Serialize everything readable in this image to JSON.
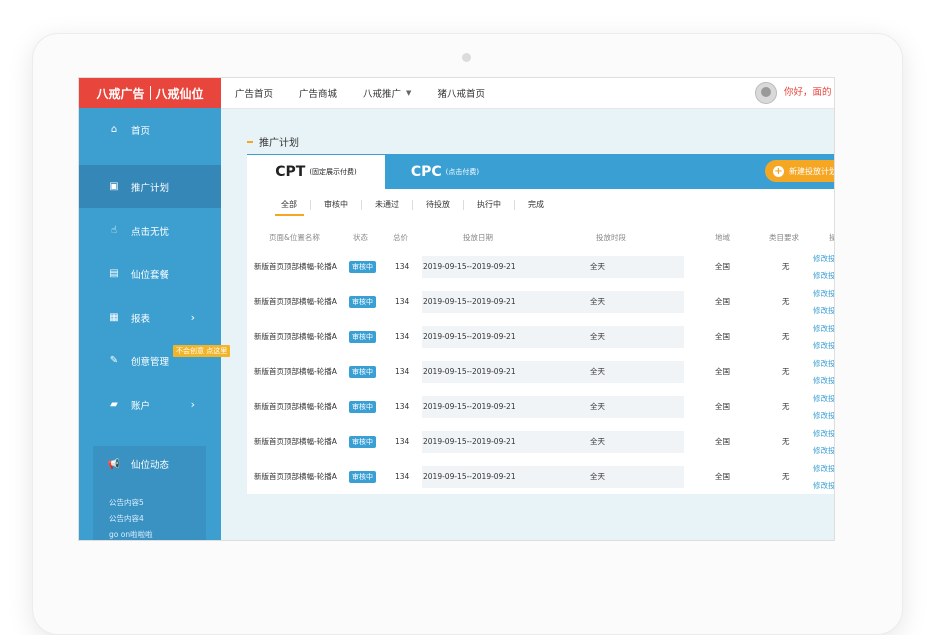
{
  "logo": {
    "left": "八戒广告",
    "right": "八戒仙位"
  },
  "topnav": [
    "广告首页",
    "广告商城",
    "八戒推广",
    "猪八戒首页"
  ],
  "user": {
    "greeting": "你好，面的"
  },
  "sidebar": {
    "items": [
      {
        "label": "首页",
        "icon": "home-icon"
      },
      {
        "label": "推广计划",
        "icon": "promotion-plan-icon"
      },
      {
        "label": "点击无忧",
        "icon": "click-icon"
      },
      {
        "label": "仙位套餐",
        "icon": "package-icon"
      },
      {
        "label": "报表",
        "icon": "report-icon"
      },
      {
        "label": "创意管理",
        "icon": "brush-icon"
      },
      {
        "label": "账户",
        "icon": "account-icon"
      }
    ],
    "hint": "不会创意 点这里",
    "dynamic": {
      "title": "仙位动态",
      "items": [
        "公告内容5",
        "公告内容4",
        "go on啦啦啦"
      ]
    }
  },
  "section_title": "推广计划",
  "tabs": [
    {
      "name": "CPT",
      "desc": "(固定展示付费)"
    },
    {
      "name": "CPC",
      "desc": "(点击付费)"
    }
  ],
  "new_button": "新建投放计划",
  "subtabs": [
    "全部",
    "审核中",
    "未通过",
    "待投放",
    "执行中",
    "完成"
  ],
  "table": {
    "headers": [
      "页面&位置名称",
      "状态",
      "总价",
      "投放日期",
      "投放时段",
      "地域",
      "类目要求",
      "操"
    ],
    "rows": [
      {
        "name": "新版首页顶部横幅-轮播A",
        "status": "审核中",
        "price": "134",
        "date": "2019-09-15--2019-09-21",
        "period": "全天",
        "region": "全国",
        "category": "无",
        "act1": "修改投",
        "act2": "修改投"
      },
      {
        "name": "新版首页顶部横幅-轮播A",
        "status": "审核中",
        "price": "134",
        "date": "2019-09-15--2019-09-21",
        "period": "全天",
        "region": "全国",
        "category": "无",
        "act1": "修改投",
        "act2": "修改投"
      },
      {
        "name": "新版首页顶部横幅-轮播A",
        "status": "审核中",
        "price": "134",
        "date": "2019-09-15--2019-09-21",
        "period": "全天",
        "region": "全国",
        "category": "无",
        "act1": "修改投",
        "act2": "修改投"
      },
      {
        "name": "新版首页顶部横幅-轮播A",
        "status": "审核中",
        "price": "134",
        "date": "2019-09-15--2019-09-21",
        "period": "全天",
        "region": "全国",
        "category": "无",
        "act1": "修改投",
        "act2": "修改投"
      },
      {
        "name": "新版首页顶部横幅-轮播A",
        "status": "审核中",
        "price": "134",
        "date": "2019-09-15--2019-09-21",
        "period": "全天",
        "region": "全国",
        "category": "无",
        "act1": "修改投",
        "act2": "修改投"
      },
      {
        "name": "新版首页顶部横幅-轮播A",
        "status": "审核中",
        "price": "134",
        "date": "2019-09-15--2019-09-21",
        "period": "全天",
        "region": "全国",
        "category": "无",
        "act1": "修改投",
        "act2": "修改投"
      },
      {
        "name": "新版首页顶部横幅-轮播A",
        "status": "审核中",
        "price": "134",
        "date": "2019-09-15--2019-09-21",
        "period": "全天",
        "region": "全国",
        "category": "无",
        "act1": "修改投",
        "act2": "修改投"
      }
    ]
  },
  "colors": {
    "brand_red": "#e8453c",
    "sidebar_blue": "#3c9fd0",
    "accent_orange": "#f5a623",
    "status_blue": "#3aa0d4"
  }
}
